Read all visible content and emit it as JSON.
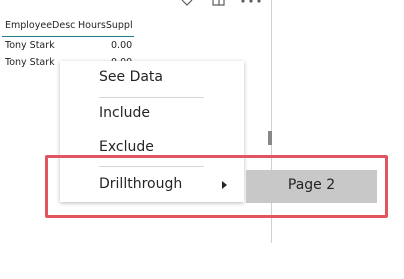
{
  "table": {
    "columns": [
      "EmployeeDesc",
      "HoursSuppl"
    ],
    "rows": [
      {
        "employee": "Tony Stark",
        "hours": "0.00"
      },
      {
        "employee": "Tony Stark",
        "hours": "0.00"
      }
    ]
  },
  "context_menu": {
    "items": [
      {
        "label": "See Data"
      },
      {
        "label": "Include"
      },
      {
        "label": "Exclude"
      },
      {
        "label": "Drillthrough"
      }
    ]
  },
  "submenu": {
    "items": [
      {
        "label": "Page 2"
      }
    ]
  },
  "colors": {
    "highlight": "#e05560",
    "header_underline": "#1f7a8c",
    "submenu_bg": "#c8c8c8"
  }
}
